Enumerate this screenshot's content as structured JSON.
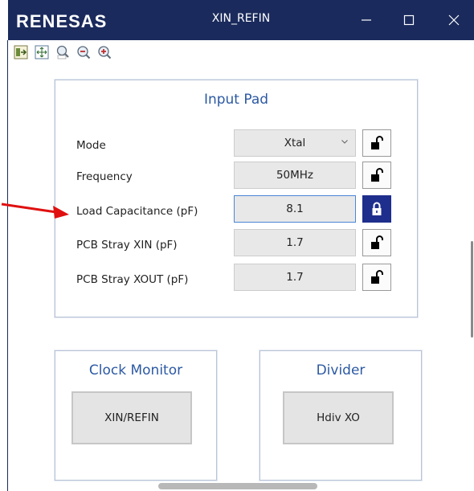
{
  "window": {
    "logo": "RENESAS",
    "title": "XIN_REFIN",
    "minimize_symbol": "—",
    "maximize_symbol": "☐",
    "close_symbol": "✕"
  },
  "toolbar": {
    "icons": [
      "export-icon",
      "fit-to-window-icon",
      "zoom-100-icon",
      "zoom-out-icon",
      "zoom-in-icon"
    ]
  },
  "input_pad": {
    "title": "Input Pad",
    "rows": [
      {
        "label": "Mode",
        "value": "Xtal",
        "has_dropdown": true,
        "locked": false
      },
      {
        "label": "Frequency",
        "value": "50MHz",
        "has_dropdown": false,
        "locked": false
      },
      {
        "label": "Load Capacitance (pF)",
        "value": "8.1",
        "has_dropdown": false,
        "locked": true
      },
      {
        "label": "PCB Stray XIN (pF)",
        "value": "1.7",
        "has_dropdown": false,
        "locked": false
      },
      {
        "label": "PCB Stray XOUT (pF)",
        "value": "1.7",
        "has_dropdown": false,
        "locked": false
      }
    ]
  },
  "clock_monitor": {
    "title": "Clock Monitor",
    "button": "XIN/REFIN"
  },
  "divider": {
    "title": "Divider",
    "button": "Hdiv XO"
  },
  "colors": {
    "title_bar": "#1a2a5c",
    "accent_text": "#2c59a3",
    "lock_active": "#1e2e8c",
    "annotation_arrow": "#e01010"
  }
}
